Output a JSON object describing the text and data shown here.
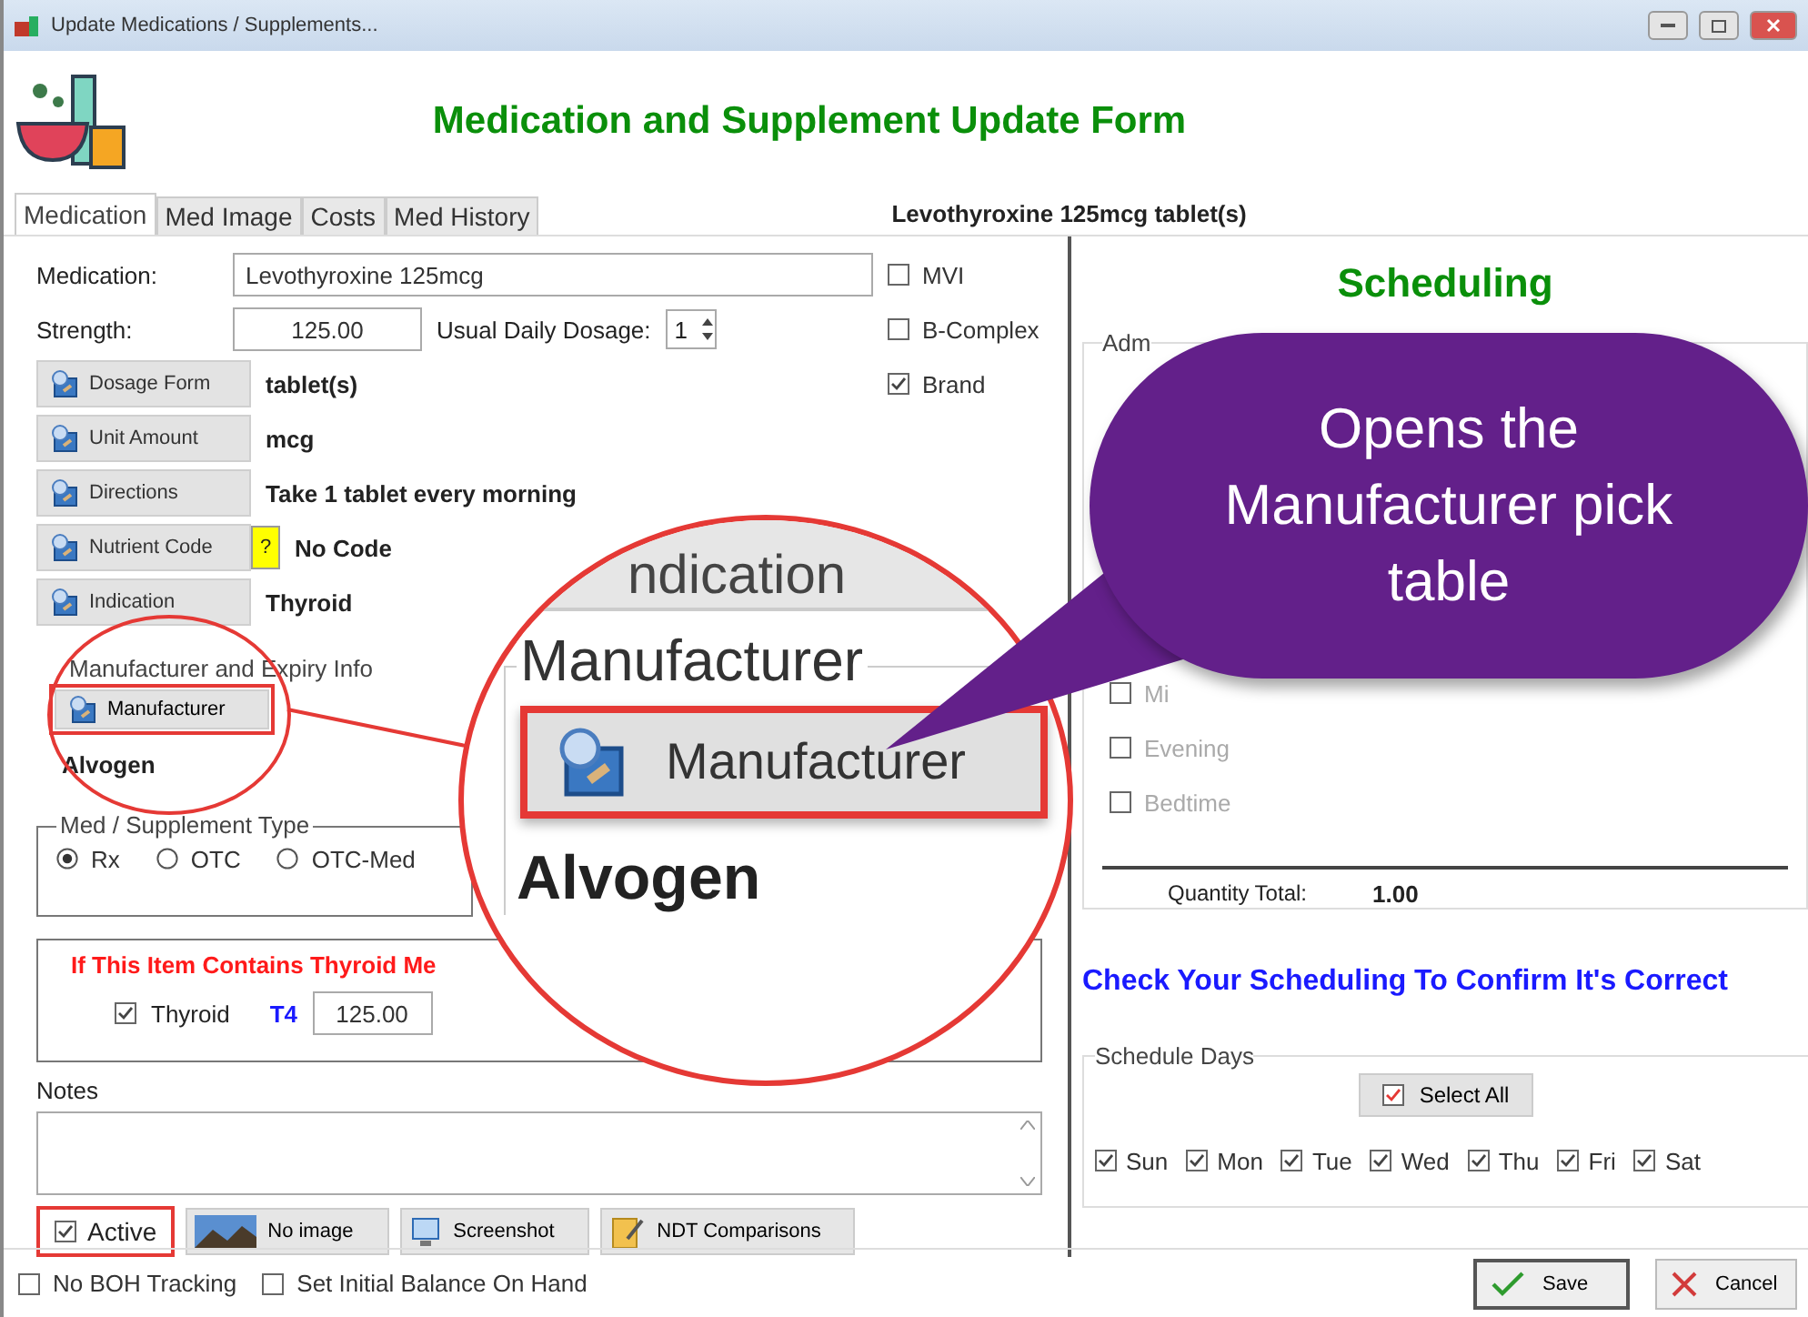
{
  "window": {
    "title": "Update Medications / Supplements..."
  },
  "header": {
    "title": "Medication and Supplement Update Form"
  },
  "tabs": [
    {
      "label": "Medication",
      "selected": true
    },
    {
      "label": "Med Image",
      "selected": false
    },
    {
      "label": "Costs",
      "selected": false
    },
    {
      "label": "Med History",
      "selected": false
    }
  ],
  "summary": "Levothyroxine 125mcg tablet(s)",
  "medication": {
    "label": "Medication:",
    "value": "Levothyroxine 125mcg"
  },
  "strength": {
    "label": "Strength:",
    "value": "125.00",
    "dosage_label": "Usual Daily Dosage:",
    "dosage_value": "1"
  },
  "flags": [
    {
      "label": "MVI",
      "checked": false
    },
    {
      "label": "B-Complex",
      "checked": false
    },
    {
      "label": "Brand",
      "checked": true
    }
  ],
  "lookups": [
    {
      "button": "Dosage Form",
      "value": "tablet(s)"
    },
    {
      "button": "Unit Amount",
      "value": "mcg"
    },
    {
      "button": "Directions",
      "value": "Take 1 tablet every morning"
    },
    {
      "button": "Nutrient Code",
      "value": "No Code",
      "help": "?"
    },
    {
      "button": "Indication",
      "value": "Thyroid"
    }
  ],
  "manufacturer": {
    "legend": "Manufacturer and Expiry Info",
    "button": "Manufacturer",
    "value": "Alvogen"
  },
  "med_type": {
    "legend": "Med / Supplement Type",
    "options": [
      {
        "label": "Rx",
        "selected": true
      },
      {
        "label": "OTC",
        "selected": false
      },
      {
        "label": "OTC-Med",
        "selected": false
      }
    ]
  },
  "thyroid": {
    "title": "If This Item Contains Thyroid Me",
    "checkbox": {
      "label": "Thyroid",
      "checked": true
    },
    "t4_label": "T4",
    "t4_value": "125.00"
  },
  "notes": {
    "label": "Notes"
  },
  "active": {
    "label": "Active",
    "checked": true
  },
  "action_buttons": [
    {
      "label": "No image",
      "kind": "image"
    },
    {
      "label": "Screenshot",
      "kind": "screenshot"
    },
    {
      "label": "NDT Comparisons",
      "kind": "compare"
    }
  ],
  "footer": {
    "checkboxes": [
      {
        "label": "No BOH Tracking",
        "checked": false
      },
      {
        "label": "Set Initial Balance On Hand",
        "checked": false
      }
    ],
    "buttons": [
      {
        "label": "Save",
        "kind": "save"
      },
      {
        "label": "Cancel",
        "kind": "cancel"
      }
    ]
  },
  "scheduling": {
    "title": "Scheduling",
    "group_legend": "Adm",
    "times": [
      {
        "label": "Mi",
        "checked": false,
        "disabled": true
      },
      {
        "label": "Evening",
        "checked": false,
        "disabled": true
      },
      {
        "label": "Bedtime",
        "checked": false,
        "disabled": true
      }
    ],
    "quantity_label": "Quantity Total:",
    "quantity_value": "1.00",
    "notice": "Check Your Scheduling To Confirm It's Correct",
    "days_legend": "Schedule Days",
    "select_all": {
      "label": "Select All",
      "checked": true
    },
    "days": [
      {
        "label": "Sun",
        "checked": true
      },
      {
        "label": "Mon",
        "checked": true
      },
      {
        "label": "Tue",
        "checked": true
      },
      {
        "label": "Wed",
        "checked": true
      },
      {
        "label": "Thu",
        "checked": true
      },
      {
        "label": "Fri",
        "checked": true
      },
      {
        "label": "Sat",
        "checked": true
      }
    ]
  },
  "magnifier": {
    "tab_fragment": "ndication",
    "legend": "Manufacturer",
    "button": "Manufacturer",
    "value": "Alvogen"
  },
  "callout": {
    "text": "Opens the Manufacturer pick table"
  }
}
